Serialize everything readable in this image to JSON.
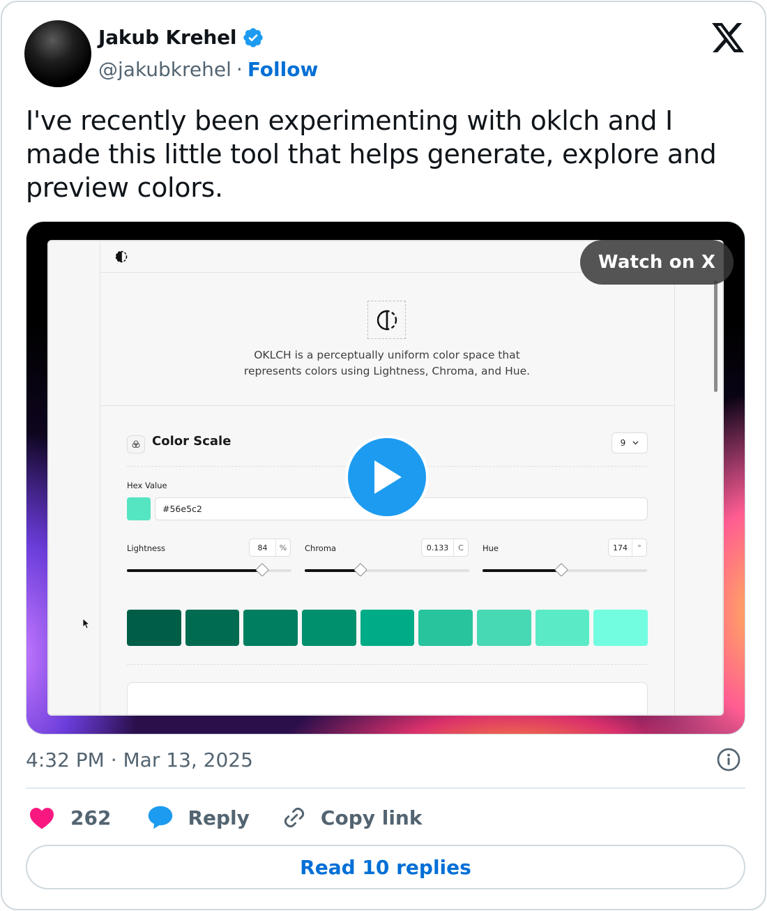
{
  "tweet": {
    "author_name": "Jakub Krehel",
    "handle": "@jakubkrehel",
    "separator": "·",
    "follow_label": "Follow",
    "text": "I've recently been experimenting with oklch and I made this little tool that helps generate, explore and preview colors.",
    "timestamp": "4:32 PM · Mar 13, 2025",
    "likes_count": "262",
    "reply_label": "Reply",
    "copy_link_label": "Copy link",
    "read_replies_label": "Read 10 replies"
  },
  "video": {
    "watch_label": "Watch on X",
    "app": {
      "description": "OKLCH is a perceptually uniform color space that represents colors using Lightness, Chroma, and Hue.",
      "section_title": "Color Scale",
      "steps_value": "9",
      "hex_label": "Hex Value",
      "hex_value": "#56e5c2",
      "lightness_label": "Lightness",
      "lightness_value": "84",
      "lightness_unit": "%",
      "lightness_level": 0.82,
      "chroma_label": "Chroma",
      "chroma_value": "0.133",
      "chroma_unit": "C",
      "chroma_level": 0.34,
      "hue_label": "Hue",
      "hue_value": "174",
      "hue_unit": "°",
      "hue_level": 0.48,
      "scale_colors": [
        "#005e47",
        "#006b51",
        "#007f60",
        "#00906d",
        "#00ac87",
        "#27c49d",
        "#47d8b4",
        "#5aebc6",
        "#72fde0"
      ]
    }
  },
  "colors": {
    "verified": "#1d9bf0",
    "link": "#006fd6",
    "like": "#f91880",
    "reply_icon": "#1d9bf0",
    "muted": "#536471"
  },
  "icons": {
    "verified": "verified-badge-icon",
    "x_logo": "x-logo-icon",
    "info": "info-icon",
    "heart": "heart-icon",
    "reply": "reply-bubble-icon",
    "link": "link-icon",
    "play": "play-icon"
  }
}
